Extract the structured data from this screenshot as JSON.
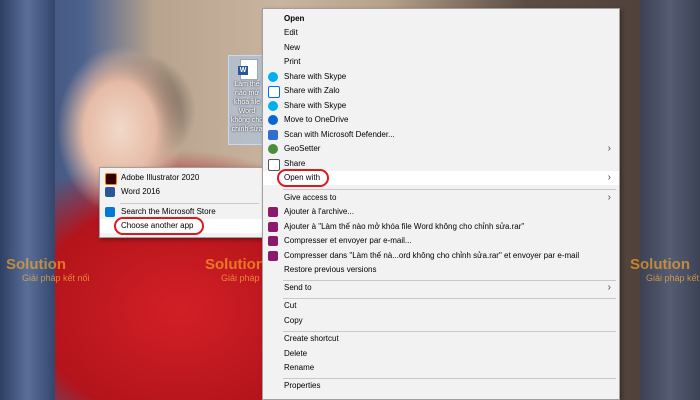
{
  "desktop": {
    "file_label": "Làm thế nào mở khoá file Word không cho chỉnh sửa",
    "watermark_brand": "Solution",
    "watermark_tagline": "Giải pháp kết nối"
  },
  "context_menu": {
    "items": {
      "open": "Open",
      "edit": "Edit",
      "new": "New",
      "print": "Print",
      "share_skype_1": "Share with Skype",
      "share_zalo": "Share with Zalo",
      "share_skype_2": "Share with Skype",
      "onedrive": "Move to OneDrive",
      "defender": "Scan with Microsoft Defender...",
      "geosetter": "GeoSetter",
      "share": "Share",
      "open_with": "Open with",
      "give_access": "Give access to",
      "add_archive": "Ajouter à l'archive...",
      "add_rar": "Ajouter à \"Làm thế nào mở khóa file Word không cho chỉnh sửa.rar\"",
      "compress_email": "Compresser et envoyer par e-mail...",
      "compress_rar_email": "Compresser dans \"Làm thế nà...ord không cho chỉnh sửa.rar\" et envoyer par e-mail",
      "restore": "Restore previous versions",
      "send_to": "Send to",
      "cut": "Cut",
      "copy": "Copy",
      "create_shortcut": "Create shortcut",
      "delete": "Delete",
      "rename": "Rename",
      "properties": "Properties"
    }
  },
  "open_with_submenu": {
    "items": {
      "illustrator": "Adobe Illustrator 2020",
      "word": "Word 2016",
      "store": "Search the Microsoft Store",
      "choose": "Choose another app"
    }
  },
  "colors": {
    "highlight_circle": "#e0171f",
    "skype": "#00aff0",
    "word": "#2b579a",
    "illustrator": "#ff7c00",
    "winrar": "#8b1a6b"
  }
}
